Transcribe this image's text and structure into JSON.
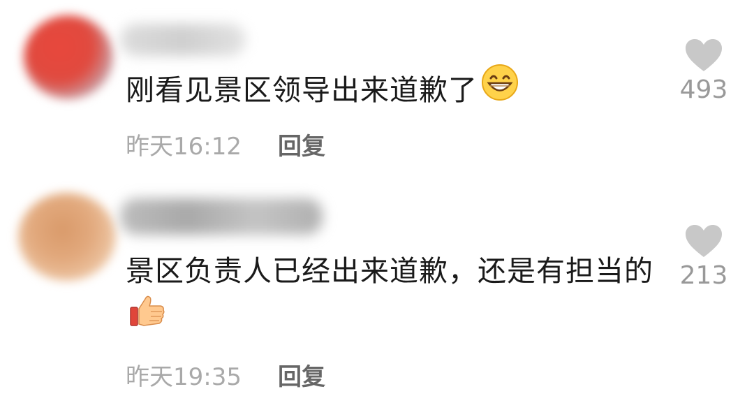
{
  "comments": [
    {
      "text": "刚看见景区领导出来道歉了",
      "emoji": "grinning-face",
      "time": "昨天16:12",
      "reply_label": "回复",
      "likes": "493"
    },
    {
      "text": "景区负责人已经出来道歉，还是有担当的",
      "emoji": "thumbs-up",
      "time": "昨天19:35",
      "reply_label": "回复",
      "likes": "213"
    }
  ],
  "colors": {
    "text": "#1a1a1a",
    "meta": "#a9a9a9",
    "reply": "#666666",
    "heart": "#c8c8c8"
  }
}
